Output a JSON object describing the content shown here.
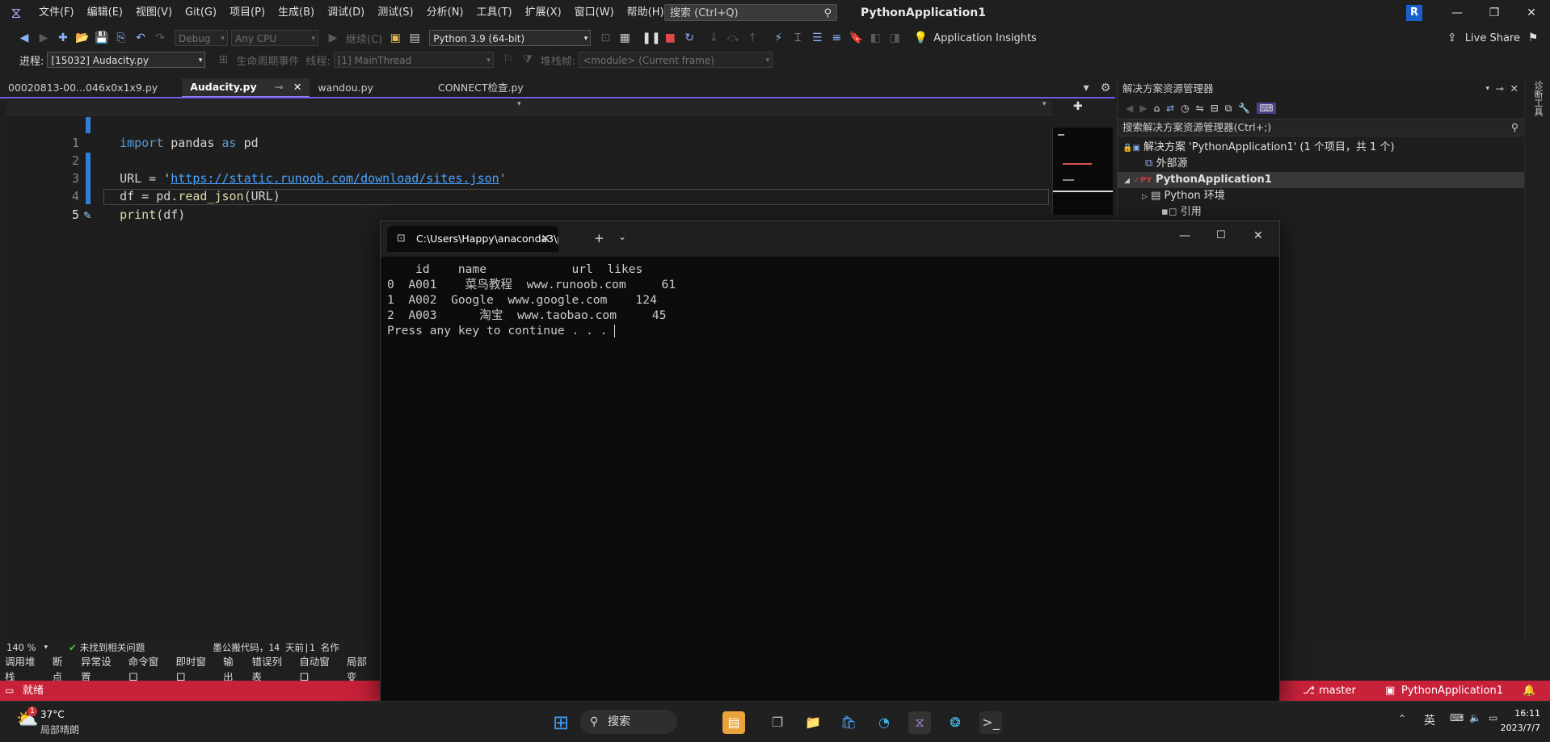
{
  "menubar": {
    "items": [
      "文件(F)",
      "编辑(E)",
      "视图(V)",
      "Git(G)",
      "项目(P)",
      "生成(B)",
      "调试(D)",
      "测试(S)",
      "分析(N)",
      "工具(T)",
      "扩展(X)",
      "窗口(W)",
      "帮助(H)"
    ],
    "search_placeholder": "搜索 (Ctrl+Q)",
    "app_title": "PythonApplication1",
    "avatar_letter": "R"
  },
  "toolbar": {
    "config": "Debug",
    "platform": "Any CPU",
    "continue": "继续(C)",
    "python_env": "Python 3.9 (64-bit)",
    "insights": "Application Insights",
    "live_share": "Live Share"
  },
  "debugbar": {
    "process_label": "进程:",
    "process_value": "[15032] Audacity.py",
    "lifecycle": "生命周期事件",
    "thread_label": "线程:",
    "thread_value": "[1] MainThread",
    "stack_label": "堆栈帧:",
    "stack_value": "<module> (Current frame)"
  },
  "tabs": [
    {
      "label": "00020813-00...046x0x1x9.py"
    },
    {
      "label": "Audacity.py"
    },
    {
      "label": "wandou.py"
    },
    {
      "label": "CONNECT检查.py"
    }
  ],
  "code": {
    "line_numbers": [
      "1",
      "2",
      "3",
      "4",
      "5"
    ],
    "l1_kw": "import",
    "l1_mid": " pandas ",
    "l1_kw2": "as",
    "l1_end": " pd",
    "l3_start": "URL = '",
    "l3_url": "https://static.runoob.com/download/sites.json",
    "l3_end": "'",
    "l4_start": "df = pd.",
    "l4_fn": "read_json",
    "l4_end": "(URL)",
    "l5_fn": "print",
    "l5_end": "(df)"
  },
  "editor_status": {
    "zoom": "140 %",
    "issues": "未找到相关问题",
    "codelens": "墨公搬代码，14 天前|1 名作"
  },
  "bottom_tabs": [
    "调用堆栈",
    "断点",
    "异常设置",
    "命令窗口",
    "即时窗口",
    "输出",
    "错误列表",
    "自动窗口",
    "局部变"
  ],
  "statusbar": {
    "ready": "就绪",
    "branch": "master",
    "project": "PythonApplication1"
  },
  "solution_explorer": {
    "title": "解决方案资源管理器",
    "search": "搜索解决方案资源管理器(Ctrl+;)",
    "items": [
      "解决方案 'PythonApplication1' (1 个项目，共 1 个)",
      "外部源",
      "PythonApplication1",
      "Python 环境",
      "引用"
    ]
  },
  "side_strip_label": "诊断工具",
  "console": {
    "tab_title": "C:\\Users\\Happy\\anaconda3\\p",
    "lines": [
      "    id    name            url  likes",
      "0  A001    菜鸟教程  www.runoob.com     61",
      "1  A002  Google  www.google.com    124",
      "2  A003      淘宝  www.taobao.com     45",
      "Press any key to continue . . . "
    ]
  },
  "taskbar": {
    "weather_temp": "37°C",
    "weather_desc": "局部晴朗",
    "weather_badge": "1",
    "search": "搜索",
    "ime": "英",
    "time": "16:11",
    "date": "2023/7/7"
  }
}
